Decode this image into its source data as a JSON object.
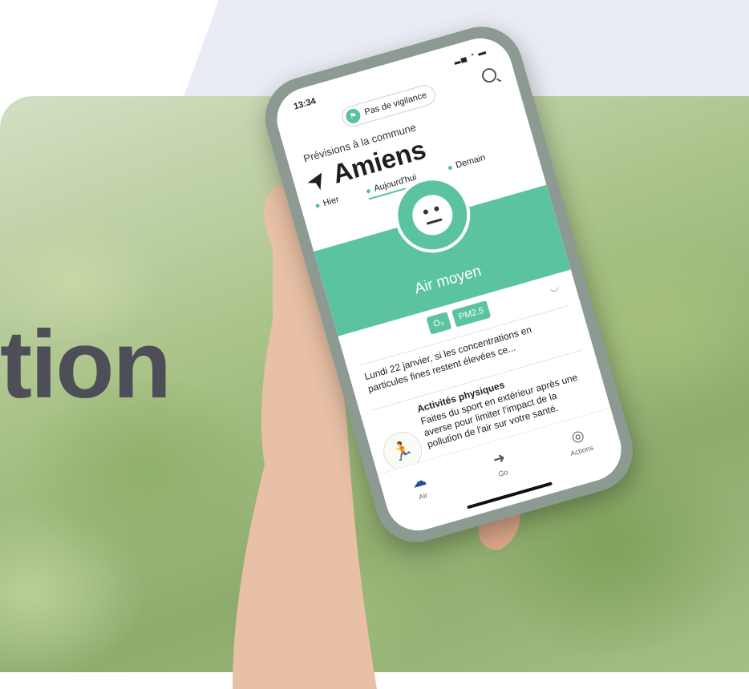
{
  "hero_word": "tion",
  "app": {
    "status": {
      "time": "13:34",
      "icons": "▂▄ ◔ ▬"
    },
    "vigilance": {
      "label": "Pas de vigilance"
    },
    "forecast_label": "Prévisions à la commune",
    "city": "Amiens",
    "days": [
      {
        "label": "Hier",
        "active": false
      },
      {
        "label": "Aujourd'hui",
        "active": true
      },
      {
        "label": "Demain",
        "active": false
      }
    ],
    "air_quality": {
      "label": "Air moyen",
      "color": "#5cc3a1"
    },
    "pollutants": [
      "O₃",
      "PM2.5"
    ],
    "forecast_text": "Lundi 22 janvier, si les concentrations en particules fines restent élevées ce...",
    "tip": {
      "title": "Activités physiques",
      "body": "Faites du sport en extérieur après une averse pour limiter l'impact de la pollution de l'air sur votre santé."
    },
    "nav": [
      {
        "label": "Air",
        "icon": "cloud-icon"
      },
      {
        "label": "Go",
        "icon": "arrow-right-icon"
      },
      {
        "label": "Actions",
        "icon": "lifebuoy-icon"
      }
    ]
  }
}
